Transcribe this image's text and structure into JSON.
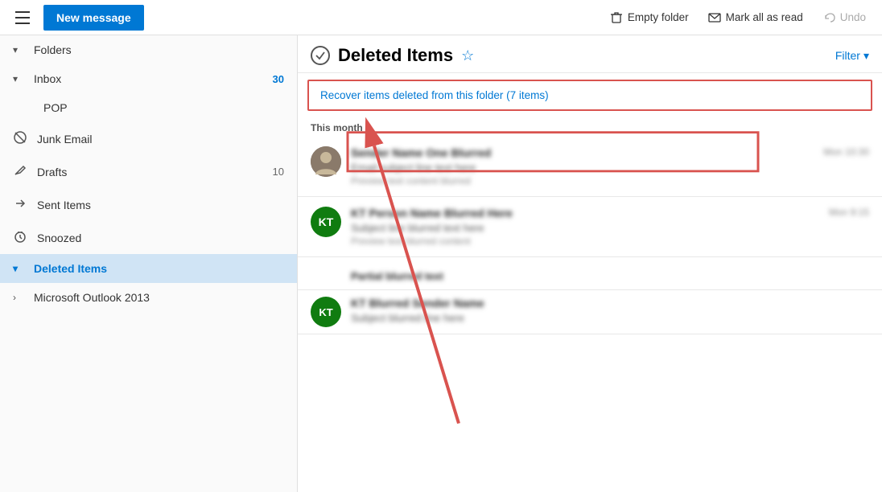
{
  "toolbar": {
    "hamburger_label": "Menu",
    "new_message_label": "New message",
    "empty_folder_label": "Empty folder",
    "mark_all_read_label": "Mark all as read",
    "undo_label": "Undo"
  },
  "sidebar": {
    "folders_label": "Folders",
    "inbox_label": "Inbox",
    "inbox_count": "30",
    "pop_label": "POP",
    "junk_email_label": "Junk Email",
    "drafts_label": "Drafts",
    "drafts_count": "10",
    "sent_items_label": "Sent Items",
    "snoozed_label": "Snoozed",
    "deleted_items_label": "Deleted Items",
    "outlook_2013_label": "Microsoft Outlook 2013"
  },
  "email_list": {
    "folder_title": "Deleted Items",
    "filter_label": "Filter",
    "recover_banner": "Recover items deleted from this folder (7 items)",
    "section_label": "This month",
    "emails": [
      {
        "sender": "Sender Name One",
        "subject": "Email subject line blurred",
        "preview": "Preview text blurred here",
        "time": "blurred",
        "avatar_type": "photo",
        "avatar_initials": ""
      },
      {
        "sender": "KT Person Name",
        "subject": "Another email subject blurred",
        "preview": "Preview text blurred here too",
        "time": "blurred",
        "avatar_type": "green",
        "avatar_initials": "KT"
      },
      {
        "sender": "Partial Sender",
        "subject": "",
        "preview": "",
        "time": "",
        "avatar_type": "green",
        "avatar_initials": "KT"
      }
    ]
  },
  "colors": {
    "accent": "#0078d4",
    "new_message_bg": "#0078d4",
    "deleted_active_bg": "#d0e4f5",
    "red_border": "#d9534f"
  }
}
